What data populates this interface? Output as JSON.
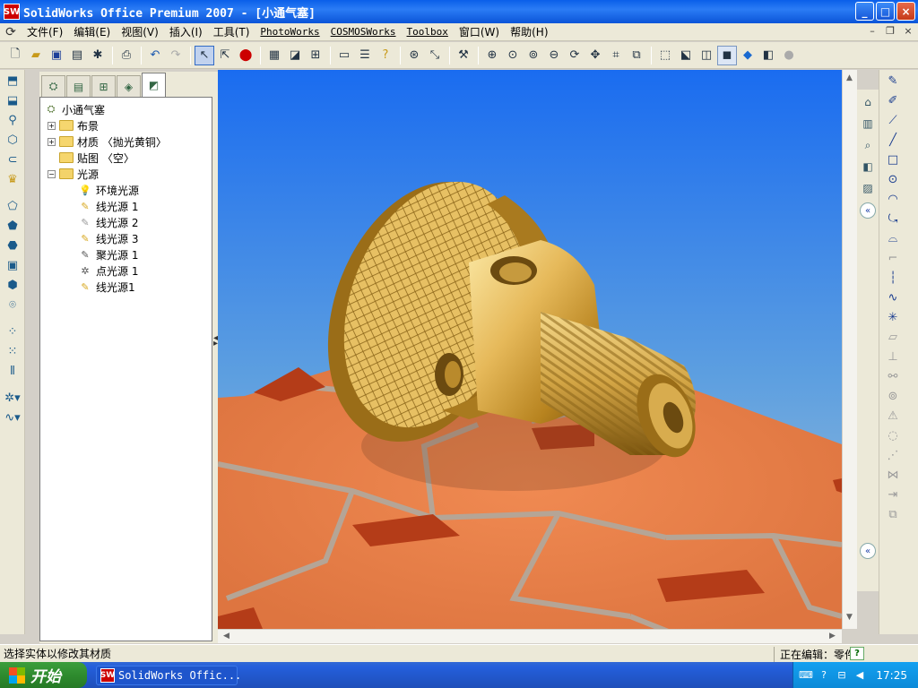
{
  "window": {
    "title": "SolidWorks Office Premium 2007 - [小通气塞]",
    "app_icon": "SW",
    "controls": {
      "minimize": "_",
      "maximize": "□",
      "close": "×"
    }
  },
  "menu": {
    "items": [
      "文件(F)",
      "编辑(E)",
      "视图(V)",
      "插入(I)",
      "工具(T)",
      "PhotoWorks",
      "COSMOSWorks",
      "Toolbox",
      "窗口(W)",
      "帮助(H)"
    ],
    "mdi_controls": [
      "–",
      "❐",
      "×"
    ]
  },
  "toolbar": {
    "icons": [
      "new-icon",
      "open-icon",
      "save-icon",
      "print-preview-icon",
      "options-icon",
      "print-icon",
      "undo-icon",
      "redo-icon",
      "select-icon",
      "select-filter-icon",
      "rebuild-icon",
      "grid-icon",
      "display-icon",
      "measure-icon",
      "view-orientation-icon",
      "properties-icon",
      "help-icon",
      "sketch-icon",
      "smart-dimension-icon",
      "tool-icon",
      "zoom-fit-icon",
      "zoom-area-icon",
      "zoom-in-icon",
      "zoom-out-icon",
      "rotate-icon",
      "pan-icon",
      "previous-view-icon",
      "standard-views-icon",
      "wireframe-icon",
      "hidden-lines-icon",
      "hlr-icon",
      "shaded-edges-icon",
      "shaded-icon",
      "shadows-icon",
      "perspective-icon"
    ]
  },
  "feature_manager": {
    "tabs": [
      "feature-tree-tab",
      "property-tab",
      "config-tab",
      "display-tab",
      "photoworks-tab"
    ],
    "tree": [
      {
        "label": "小通气塞",
        "level": 0,
        "icon": "part-icon",
        "expander": ""
      },
      {
        "label": "布景",
        "level": 1,
        "icon": "folder-icon",
        "expander": "+"
      },
      {
        "label": "材质 〈抛光黄铜〉",
        "level": 1,
        "icon": "folder-icon",
        "expander": "+"
      },
      {
        "label": "贴图 〈空〉",
        "level": 1,
        "icon": "folder-icon",
        "expander": ""
      },
      {
        "label": "光源",
        "level": 1,
        "icon": "lights-folder-icon",
        "expander": "−"
      },
      {
        "label": "环境光源",
        "level": 2,
        "icon": "ambient-light-icon",
        "expander": ""
      },
      {
        "label": "线光源 1",
        "level": 2,
        "icon": "directional-light-icon",
        "expander": ""
      },
      {
        "label": "线光源 2",
        "level": 2,
        "icon": "directional-light-icon",
        "expander": ""
      },
      {
        "label": "线光源 3",
        "level": 2,
        "icon": "directional-light-icon",
        "expander": ""
      },
      {
        "label": "聚光源 1",
        "level": 2,
        "icon": "spot-light-icon",
        "expander": ""
      },
      {
        "label": "点光源 1",
        "level": 2,
        "icon": "point-light-icon",
        "expander": ""
      },
      {
        "label": "线光源1",
        "level": 2,
        "icon": "directional-light-icon",
        "expander": ""
      }
    ]
  },
  "status": {
    "message": "选择实体以修改其材质",
    "editing": "正在编辑：零件",
    "help": "?"
  },
  "taskbar": {
    "start": "开始",
    "task_button": "SolidWorks Offic...",
    "clock": "17:25"
  },
  "colors": {
    "brass_light": "#f4d87a",
    "brass_mid": "#c9962f",
    "brass_dark": "#6b4a10",
    "floor_orange": "#e8834a",
    "floor_dark": "#b8401a",
    "grout": "#b8a89a"
  }
}
